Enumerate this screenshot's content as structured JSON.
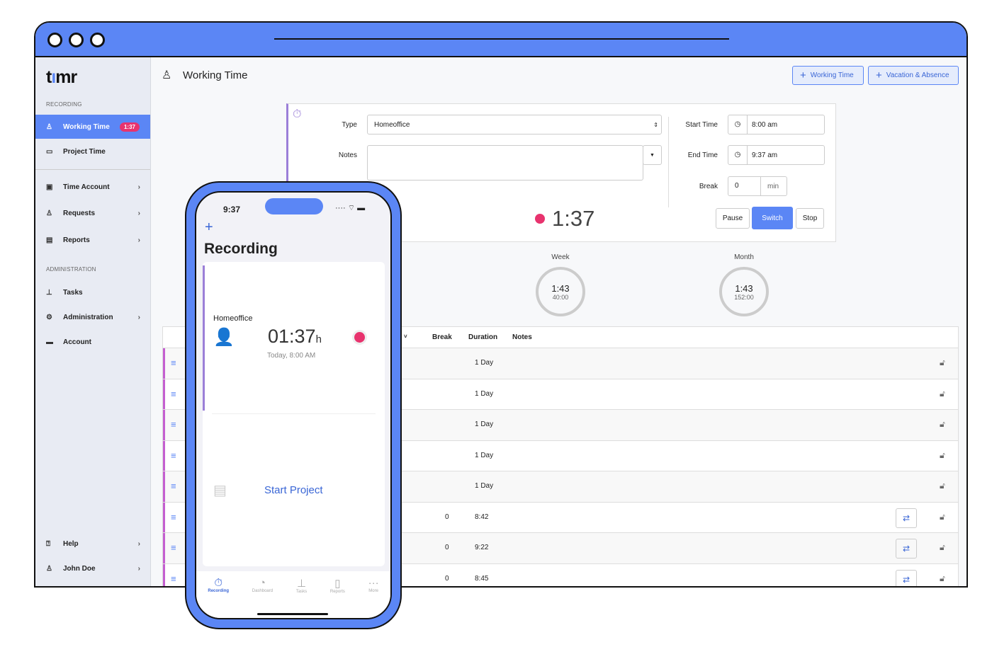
{
  "app": {
    "logo": "timr"
  },
  "sidebar": {
    "sections": [
      "RECORDING",
      "ADMINISTRATION"
    ],
    "items": [
      {
        "label": "Working Time",
        "icon": "user-clock-icon",
        "badge": "1:37",
        "active": true
      },
      {
        "label": "Project Time",
        "icon": "briefcase-clock-icon"
      },
      {
        "label": "Time Account",
        "icon": "account-file-icon",
        "chevron": true
      },
      {
        "label": "Requests",
        "icon": "user-check-icon",
        "chevron": true
      },
      {
        "label": "Reports",
        "icon": "report-icon",
        "chevron": true
      },
      {
        "label": "Tasks",
        "icon": "hierarchy-icon"
      },
      {
        "label": "Administration",
        "icon": "gear-icon",
        "chevron": true
      },
      {
        "label": "Account",
        "icon": "card-icon"
      },
      {
        "label": "Help",
        "icon": "help-icon",
        "chevron": true
      },
      {
        "label": "John Doe",
        "icon": "user-icon",
        "chevron": true
      }
    ]
  },
  "header": {
    "title": "Working Time",
    "buttons": [
      "Working Time",
      "Vacation & Absence"
    ]
  },
  "recording": {
    "type_label": "Type",
    "type_value": "Homeoffice",
    "notes_label": "Notes",
    "notes_value": "",
    "start_label": "Start Time",
    "start_value": "8:00 am",
    "end_label": "End Time",
    "end_value": "9:37 am",
    "break_label": "Break",
    "break_value": "0",
    "break_unit": "min",
    "timer": "1:37",
    "buttons": [
      "Pause",
      "Switch",
      "Stop"
    ],
    "accent": "#5b86f5",
    "recording_color": "#e8336e"
  },
  "summary": [
    {
      "label": "Week",
      "value": "1:43",
      "target": "40:00"
    },
    {
      "label": "Month",
      "value": "1:43",
      "target": "152:00"
    }
  ],
  "table": {
    "headers": [
      "Break",
      "Duration",
      "Notes"
    ],
    "rows": [
      {
        "break": "",
        "duration": "1 Day"
      },
      {
        "break": "",
        "duration": "1 Day"
      },
      {
        "break": "",
        "duration": "1 Day"
      },
      {
        "break": "",
        "duration": "1 Day"
      },
      {
        "break": "",
        "duration": "1 Day"
      },
      {
        "break": "0",
        "duration": "8:42",
        "switch": true
      },
      {
        "break": "0",
        "duration": "9:22",
        "switch": true
      },
      {
        "break": "0",
        "duration": "8:45",
        "switch": true
      }
    ]
  },
  "phone": {
    "time": "9:37",
    "title": "Recording",
    "type": "Homeoffice",
    "timer": "01:37",
    "unit": "h",
    "since": "Today, 8:00 AM",
    "start_project": "Start Project",
    "tabs": [
      "Recording",
      "Dashboard",
      "Tasks",
      "Reports",
      "More"
    ]
  }
}
